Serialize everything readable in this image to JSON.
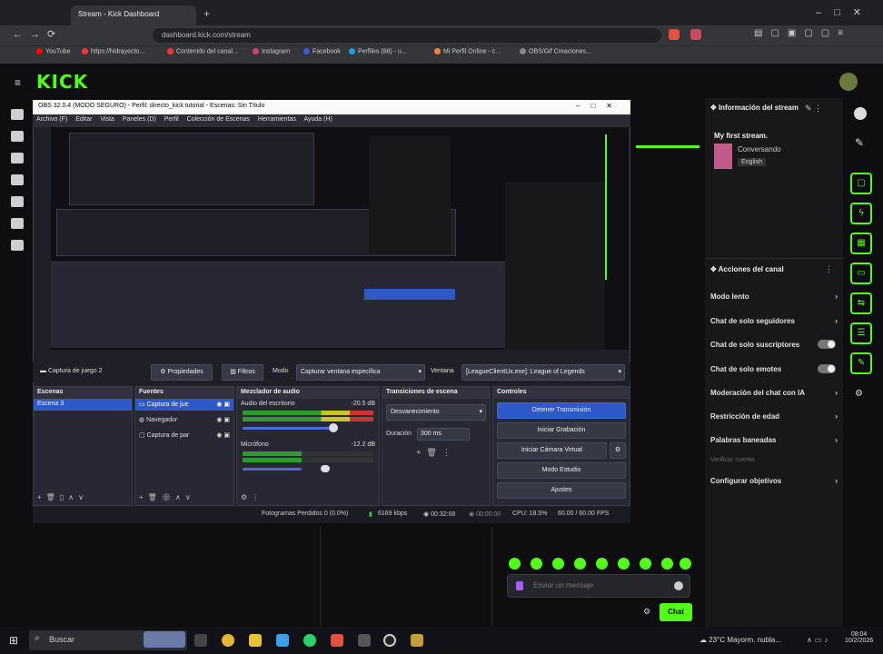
{
  "browser": {
    "tabs": [
      "Stream - Kick Dashboard"
    ],
    "url": "dashboard.kick.com/stream",
    "bookmarks": [
      "YouTube",
      "https://hidrayecto...",
      "Contenido del canal...",
      "Instagram",
      "Facebook",
      "Perfiles (88) - u...",
      "Mi Perfil Online - c...",
      "OBS/Gif Creaciones..."
    ]
  },
  "kick": {
    "logo": "KICK",
    "info": {
      "header": "Información del stream",
      "title": "My first stream.",
      "category": "Conversando",
      "language": "English"
    },
    "actions": {
      "header": "Acciones del canal",
      "items": [
        "Modo lento",
        "Chat de solo seguidores",
        "Chat de solo suscriptores",
        "Chat de solo emotes",
        "Moderación del chat con IA",
        "Restricción de edad",
        "Palabras baneadas",
        "Configurar objetivos"
      ],
      "sub_item": "Verificar cuenta"
    },
    "chat": {
      "placeholder": "Enviar un mensaje",
      "send": "Chat"
    }
  },
  "obs": {
    "title": "OBS 32.0.4 (MODO SEGURO) - Perfil: directo_kick tutorial - Escenas: Sin Título",
    "menu": [
      "Archivo (F)",
      "Editar",
      "Vista",
      "Paneles (D)",
      "Perfil",
      "Colección de Escenas",
      "Herramientas",
      "Ayuda (H)"
    ],
    "source_bar": {
      "source": "Captura de juego 2",
      "properties": "Propiedades",
      "filters": "Filtros",
      "mode_label": "Modo",
      "mode_value": "Capturar ventana específica",
      "window_label": "Ventana",
      "window_value": "[LeagueClientUx.exe]: League of Legends"
    },
    "scenes": {
      "header": "Escenas",
      "items": [
        "Escena 3"
      ]
    },
    "sources": {
      "header": "Fuentes",
      "items": [
        "Captura de jue",
        "Navegador",
        "Captura de par"
      ]
    },
    "mixer": {
      "header": "Mezclador de audio",
      "channels": [
        {
          "name": "Audio del escritorio",
          "db": "-20.5 dB",
          "level": 0.72
        },
        {
          "name": "Micrófono",
          "db": "-12.2 dB",
          "level": 0.45
        }
      ]
    },
    "transitions": {
      "header": "Transiciones de escena",
      "type": "Desvanecimiento",
      "duration_label": "Duración",
      "duration": "300 ms"
    },
    "controls": {
      "header": "Controles",
      "buttons": [
        "Detener Transmisión",
        "Iniciar Grabación",
        "Iniciar Cámara Virtual",
        "Modo Estudio",
        "Ajustes"
      ]
    },
    "status": {
      "dropped": "Fotogramas Perdidos 0 (0.0%)",
      "bitrate": "6169 kbps",
      "live_time": "00:32:08",
      "rec_time": "00:00:00",
      "cpu": "CPU: 18.5%",
      "fps": "60.00 / 60.00 FPS"
    }
  },
  "taskbar": {
    "search": "Buscar",
    "weather": "23°C  Mayorm. nubla...",
    "time": "08:04",
    "date": "10/2/2026"
  }
}
